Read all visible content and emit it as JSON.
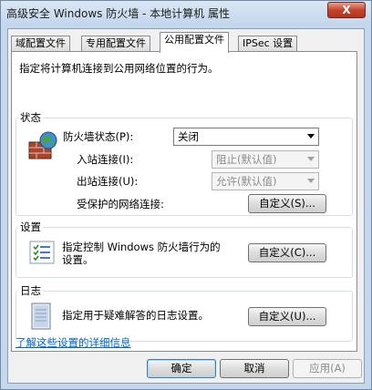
{
  "window": {
    "title": "高级安全 Windows 防火墙 - 本地计算机 属性",
    "close_label": "X"
  },
  "tabs": [
    {
      "label": "域配置文件",
      "active": false
    },
    {
      "label": "专用配置文件",
      "active": false
    },
    {
      "label": "公用配置文件",
      "active": true
    },
    {
      "label": "IPSec 设置",
      "active": false
    }
  ],
  "panel": {
    "description": "指定将计算机连接到公用网络位置的行为。",
    "state": {
      "group_label": "状态",
      "firewall_label": "防火墙状态(P):",
      "firewall_value": "关闭",
      "inbound_label": "入站连接(I):",
      "inbound_value": "阻止(默认值)",
      "outbound_label": "出站连接(U):",
      "outbound_value": "允许(默认值)",
      "protected_label": "受保护的网络连接:",
      "protected_button": "自定义(S)..."
    },
    "settings": {
      "group_label": "设置",
      "text_line1": "指定控制 Windows 防火墙行为的",
      "text_line2": "设置。",
      "button": "自定义(C)..."
    },
    "logging": {
      "group_label": "日志",
      "text": "指定用于疑难解答的日志设置。",
      "button": "自定义(U)..."
    }
  },
  "footer": {
    "link": "了解这些设置的详细信息",
    "ok": "确定",
    "cancel": "取消",
    "apply": "应用(A)"
  }
}
